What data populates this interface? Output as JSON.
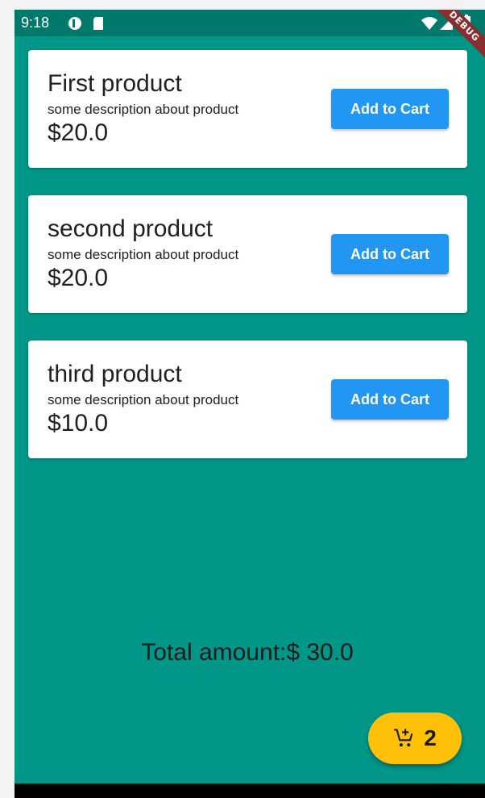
{
  "status_bar": {
    "time": "9:18",
    "icons": [
      "notification-icon",
      "sd-card-icon",
      "wifi-icon",
      "signal-icon",
      "battery-icon"
    ]
  },
  "debug_banner": "DEBUG",
  "products": [
    {
      "name": "First product",
      "description": "some description about product",
      "price": "$20.0",
      "button_label": "Add to Cart"
    },
    {
      "name": "second product",
      "description": "some description about product",
      "price": "$20.0",
      "button_label": "Add to Cart"
    },
    {
      "name": "third product",
      "description": "some description about product",
      "price": "$10.0",
      "button_label": "Add to Cart"
    }
  ],
  "total": {
    "text": "Total amount:$ 30.0"
  },
  "cart_fab": {
    "count": "2",
    "icon": "add-shopping-cart-icon"
  },
  "colors": {
    "background": "#009688",
    "status_bar": "#00796b",
    "button": "#2196f3",
    "fab": "#ffc107",
    "debug_banner": "#8b2d2d"
  }
}
